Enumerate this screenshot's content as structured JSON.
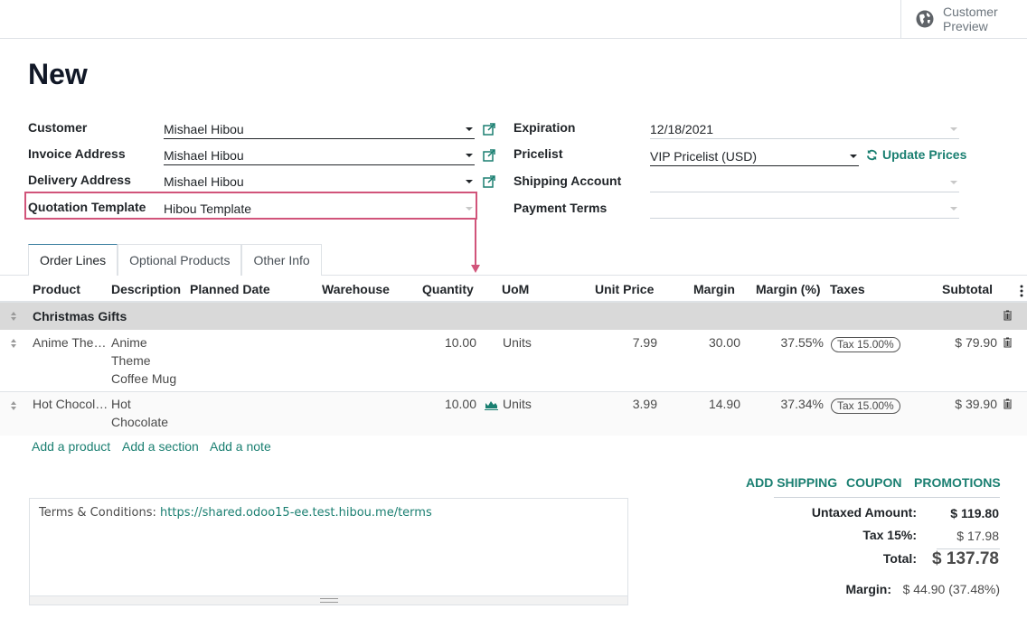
{
  "header": {
    "customer_preview_line1": "Customer",
    "customer_preview_line2": "Preview"
  },
  "title": "New",
  "left_fields": [
    {
      "label": "Customer",
      "value": "Mishael Hibou"
    },
    {
      "label": "Invoice Address",
      "value": "Mishael Hibou"
    },
    {
      "label": "Delivery Address",
      "value": "Mishael Hibou"
    },
    {
      "label": "Quotation Template",
      "value": "Hibou Template"
    }
  ],
  "right_fields": [
    {
      "label": "Expiration",
      "value": "12/18/2021"
    },
    {
      "label": "Pricelist",
      "value": "VIP Pricelist (USD)"
    },
    {
      "label": "Shipping Account",
      "value": ""
    },
    {
      "label": "Payment Terms",
      "value": ""
    }
  ],
  "update_prices_label": "Update Prices",
  "tabs": [
    {
      "label": "Order Lines",
      "active": true
    },
    {
      "label": "Optional Products",
      "active": false
    },
    {
      "label": "Other Info",
      "active": false
    }
  ],
  "columns": [
    "Product",
    "Description",
    "Planned Date",
    "Warehouse",
    "Quantity",
    "UoM",
    "Unit Price",
    "Margin",
    "Margin (%)",
    "Taxes",
    "Subtotal"
  ],
  "section": {
    "name": "Christmas Gifts"
  },
  "lines": [
    {
      "product": "Anime The…",
      "description": [
        "Anime",
        "Theme",
        "Coffee Mug"
      ],
      "quantity": "10.00",
      "uom": "Units",
      "unit_price": "7.99",
      "margin": "30.00",
      "margin_pct": "37.55%",
      "tax": "Tax 15.00%",
      "subtotal": "$ 79.90"
    },
    {
      "product": "Hot Chocol…",
      "description": [
        "Hot",
        "Chocolate"
      ],
      "quantity": "10.00",
      "uom": "Units",
      "unit_price": "3.99",
      "margin": "14.90",
      "margin_pct": "37.34%",
      "tax": "Tax 15.00%",
      "subtotal": "$ 39.90"
    }
  ],
  "add_links": {
    "product": "Add a product",
    "section": "Add a section",
    "note": "Add a note"
  },
  "actions": {
    "add_shipping": "ADD SHIPPING",
    "coupon": "COUPON",
    "promotions": "PROMOTIONS"
  },
  "notes": {
    "prefix": "Terms & Conditions: ",
    "url": "https://shared.odoo15-ee.test.hibou.me/terms"
  },
  "totals": {
    "untaxed_label": "Untaxed Amount:",
    "untaxed_value": "$ 119.80",
    "tax_label": "Tax 15%:",
    "tax_value": "$ 17.98",
    "total_label": "Total:",
    "total_value": "$ 137.78",
    "margin_label": "Margin:",
    "margin_value": "$ 44.90 (37.48%)"
  },
  "colors": {
    "accent": "#1a7f71",
    "highlight": "#d1547a",
    "section_bg": "#d9d9d9"
  }
}
